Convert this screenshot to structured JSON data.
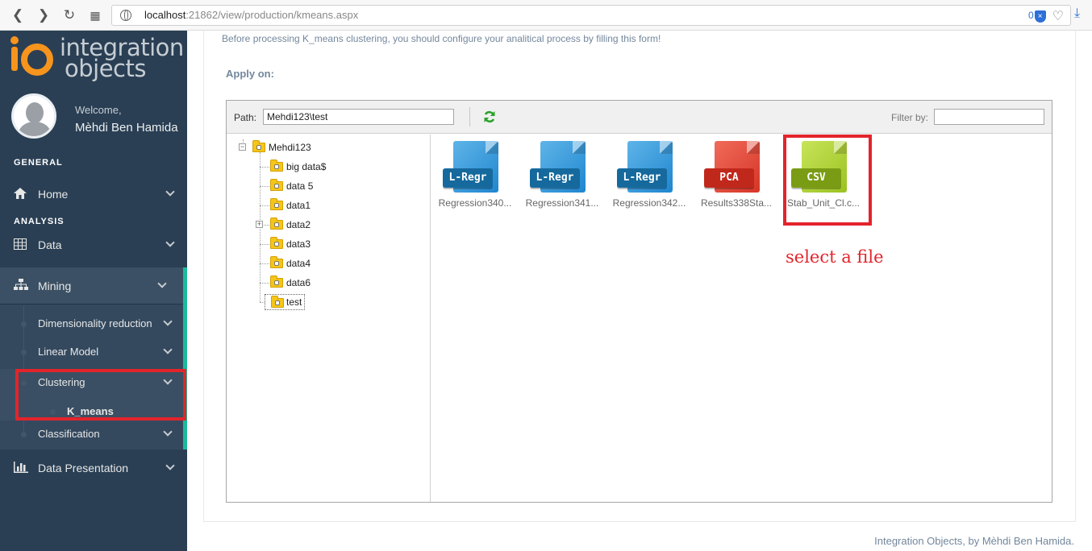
{
  "browser": {
    "url_host": "localhost",
    "url_rest": ":21862/view/production/kmeans.aspx",
    "counter": "0"
  },
  "sidebar": {
    "logo_text_line1": "integration",
    "logo_text_line2": "objects",
    "welcome": "Welcome,",
    "username": "Mèhdi Ben Hamida",
    "section_general": "GENERAL",
    "section_analysis": "ANALYSIS",
    "items": {
      "home": "Home",
      "data": "Data",
      "mining": "Mining",
      "dimensionality_reduction": "Dimensionality reduction",
      "linear_model": "Linear Model",
      "clustering": "Clustering",
      "k_means": "K_means",
      "classification": "Classification",
      "data_presentation": "Data Presentation"
    }
  },
  "main": {
    "intro": "Before processing K_means clustering, you should configure your analitical process by filling this form!",
    "apply_on": "Apply on:",
    "path_label": "Path:",
    "path_value": "Mehdi123\\test",
    "filter_label": "Filter by:",
    "filter_value": "",
    "tree": {
      "root": "Mehdi123",
      "children": [
        "big data$",
        "data 5",
        "data1",
        "data2",
        "data3",
        "data4",
        "data6",
        "test"
      ]
    },
    "files": [
      {
        "badge": "L-Regr",
        "name": "Regression340...",
        "color": "blue"
      },
      {
        "badge": "L-Regr",
        "name": "Regression341...",
        "color": "blue"
      },
      {
        "badge": "L-Regr",
        "name": "Regression342...",
        "color": "blue"
      },
      {
        "badge": "PCA",
        "name": "Results338Sta...",
        "color": "red"
      },
      {
        "badge": "CSV",
        "name": "Stab_Unit_Cl.c...",
        "color": "green"
      }
    ],
    "annotation": "select a file",
    "footer": "Integration Objects, by Mèhdi Ben Hamida."
  },
  "colors": {
    "sidebar_bg": "#2a3f54",
    "accent": "#1abb9c",
    "highlight": "#e3242b"
  }
}
